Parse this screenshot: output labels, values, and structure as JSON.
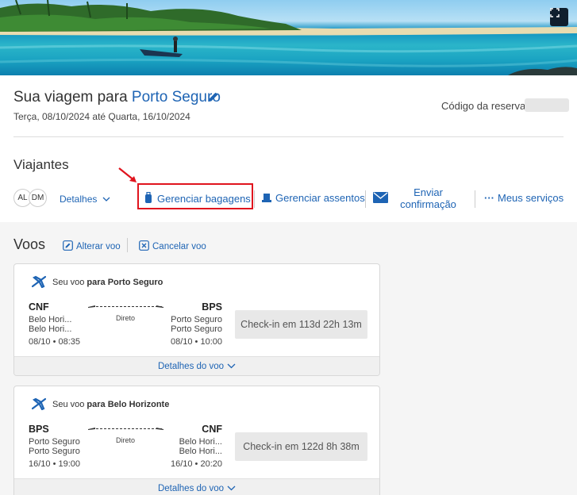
{
  "trip": {
    "title_prefix": "Sua viagem para ",
    "destination": "Porto Seguro",
    "dates": "Terça, 08/10/2024 até Quarta, 16/10/2024",
    "reservation_label": "Código da reserva:"
  },
  "travelers": {
    "title": "Viajantes",
    "avatars": [
      "AL",
      "DM"
    ],
    "details_label": "Detalhes"
  },
  "actions": {
    "baggage": "Gerenciar bagagens",
    "seats": "Gerenciar assentos",
    "confirm_line1": "Enviar",
    "confirm_line2": "confirmação",
    "services": "Meus serviços"
  },
  "flights": {
    "title": "Voos",
    "change_label": "Alterar voo",
    "cancel_label": "Cancelar voo",
    "details_label": "Detalhes do voo",
    "cards": [
      {
        "header_prefix": "Seu voo ",
        "header_bold": "para Porto Seguro",
        "origin_code": "CNF",
        "origin_city1": "Belo Hori...",
        "origin_city2": "Belo Hori...",
        "origin_time": "08/10 • 08:35",
        "dest_code": "BPS",
        "dest_city1": "Porto Seguro",
        "dest_city2": "Porto Seguro",
        "dest_time": "08/10 • 10:00",
        "stops": "Direto",
        "checkin": "Check-in em 113d 22h 13m"
      },
      {
        "header_prefix": "Seu voo ",
        "header_bold": "para Belo Horizonte",
        "origin_code": "BPS",
        "origin_city1": "Porto Seguro",
        "origin_city2": "Porto Seguro",
        "origin_time": "16/10 • 19:00",
        "dest_code": "CNF",
        "dest_city1": "Belo Hori...",
        "dest_city2": "Belo Hori...",
        "dest_time": "16/10 • 20:20",
        "stops": "Direto",
        "checkin": "Check-in em 122d 8h 38m"
      }
    ]
  },
  "colors": {
    "link": "#1e64b4",
    "highlight": "#e0141e"
  }
}
